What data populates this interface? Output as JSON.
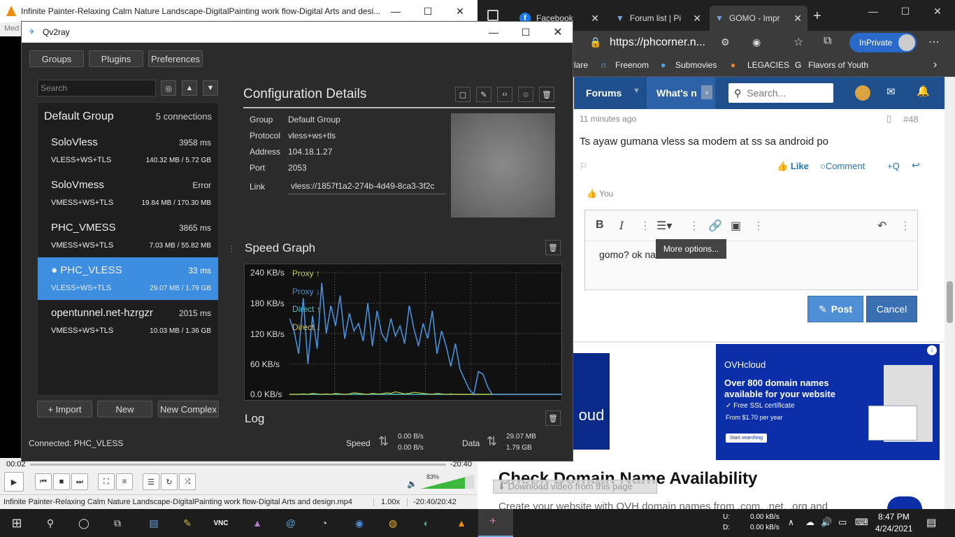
{
  "vlc": {
    "title": "Infinite Painter-Relaxing Calm Nature Landscape-DigitalPainting work flow-Digital Arts and desi...",
    "menu": "Med",
    "time_elapsed": "00:02",
    "time_remaining": "-20:40",
    "volume": "83%",
    "volume_level": 0.83,
    "status_file": "Infinite Painter-Relaxing Calm Nature Landscape-DigitalPainting work flow-Digital Arts and design.mp4",
    "status_speed": "1.00x",
    "status_time": "-20:40/20:42"
  },
  "browser": {
    "tabs": [
      {
        "label": "Facebook"
      },
      {
        "label": "Forum list | Pi"
      },
      {
        "label": "GOMO - Impr"
      }
    ],
    "address": "https://phcorner.n...",
    "inprivate": "InPrivate",
    "favorites": [
      "lare",
      "Freenom",
      "Submovies",
      "LEGACIES",
      "Flavors of Youth"
    ],
    "site": {
      "nav_forums": "Forums",
      "nav_whats_new": "What's n",
      "search_placeholder": "Search...",
      "post_time": "11 minutes ago",
      "post_number": "#48",
      "post_text": "Ts ayaw gumana vless sa modem at ss sa android po",
      "like": "Like",
      "comment": "Comment",
      "quote": "+Q",
      "reaction_you": "You",
      "editor_text": "gomo? ok naman sakin",
      "tooltip": "More options...",
      "post_btn": "Post",
      "cancel_btn": "Cancel",
      "ad_brand": "OVHcloud",
      "ad_headline": "Over 800 domain names available for your website",
      "ad_ssl": "✓ Free SSL certificate",
      "ad_price": "From $1.70 per year",
      "ad_cta": "Start searching",
      "ad_left_text": "oud",
      "heading": "Check Domain Name Availability",
      "download_overlay": "Download video from this page",
      "sub_text": "Create your website with OVH domain names from .com, .net, .org and"
    }
  },
  "qv2ray": {
    "title": "Qv2ray",
    "buttons": {
      "groups": "Groups",
      "plugins": "Plugins",
      "preferences": "Preferences"
    },
    "search_placeholder": "Search",
    "group_name": "Default Group",
    "group_count": "5 connections",
    "connections": [
      {
        "name": "SoloVless",
        "latency": "3958 ms",
        "type": "VLESS+WS+TLS",
        "stats": "140.32 MB / 5.72 GB"
      },
      {
        "name": "SoloVmess",
        "latency": "Error",
        "type": "VMESS+WS+TLS",
        "stats": "19.84 MB / 170.30 MB"
      },
      {
        "name": "PHC_VMESS",
        "latency": "3865 ms",
        "type": "VMESS+WS+TLS",
        "stats": "7.03 MB / 55.82 MB"
      },
      {
        "name": "● PHC_VLESS",
        "latency": "33 ms",
        "type": "VLESS+WS+TLS",
        "stats": "29.07 MB / 1.79 GB"
      },
      {
        "name": "opentunnel.net-hzrgzr",
        "latency": "2015 ms",
        "type": "VMESS+WS+TLS",
        "stats": "10.03 MB / 1.36 GB"
      }
    ],
    "import": "+ Import",
    "new": "New",
    "new_complex": "New Complex",
    "config_title": "Configuration Details",
    "details": [
      {
        "key": "Group",
        "value": "Default Group"
      },
      {
        "key": "Protocol",
        "value": "vless+ws+tls"
      },
      {
        "key": "Address",
        "value": "104.18.1.27"
      },
      {
        "key": "Port",
        "value": "2053"
      }
    ],
    "link_key": "Link",
    "link_value": "vless://1857f1a2-274b-4d49-8ca3-3f2c",
    "speed_graph_title": "Speed Graph",
    "log_title": "Log",
    "connected": "Connected: PHC_VLESS",
    "speed_label": "Speed",
    "speed_up": "0.00 B/s",
    "speed_down": "0.00 B/s",
    "data_label": "Data",
    "data_up": "29.07 MB",
    "data_down": "1.79 GB"
  },
  "chart_data": {
    "type": "line",
    "title": "Speed Graph",
    "y_ticks": [
      "240 KB/s",
      "180 KB/s",
      "120 KB/s",
      "60 KB/s",
      "0.0 KB/s"
    ],
    "ylim": [
      0,
      240
    ],
    "series": [
      {
        "name": "Proxy ↑",
        "color": "#b6d24a",
        "values": [
          0,
          0,
          0,
          1,
          0,
          2,
          1,
          0,
          1,
          0,
          2,
          1,
          0,
          1,
          3,
          2,
          1,
          0,
          2,
          1,
          1,
          3,
          2,
          5,
          3,
          1,
          2,
          4,
          3,
          2,
          1,
          0,
          2,
          1,
          0,
          1,
          0,
          0,
          0,
          0,
          0,
          0,
          0,
          0,
          0,
          0,
          0,
          0,
          0,
          0,
          0,
          0,
          0,
          0,
          0,
          0,
          0,
          0,
          0,
          0
        ]
      },
      {
        "name": "Proxy ↓",
        "color": "#4a90d9",
        "values": [
          150,
          125,
          80,
          190,
          60,
          155,
          90,
          220,
          120,
          175,
          135,
          195,
          110,
          160,
          125,
          140,
          105,
          180,
          95,
          165,
          120,
          105,
          150,
          115,
          135,
          100,
          175,
          130,
          95,
          140,
          110,
          165,
          80,
          125,
          95,
          55,
          100,
          50,
          30,
          10,
          0,
          45,
          40,
          15,
          0,
          0,
          0,
          0,
          0,
          0,
          0,
          0,
          0,
          0,
          0,
          0,
          0,
          0,
          0,
          0
        ]
      },
      {
        "name": "Direct ↑",
        "color": "#3ec7d6",
        "values": [
          0,
          0,
          0,
          0,
          0,
          0,
          0,
          0,
          0,
          0,
          0,
          0,
          0,
          0,
          0,
          0,
          0,
          0,
          0,
          0,
          0,
          0,
          0,
          0,
          0,
          0,
          0,
          0,
          0,
          0,
          0,
          0,
          0,
          0,
          0,
          0,
          0,
          0,
          0,
          0,
          0,
          0,
          0,
          0,
          0,
          0,
          0,
          0,
          0,
          0,
          0,
          0,
          0,
          0,
          0,
          0,
          0,
          0,
          0,
          0
        ]
      },
      {
        "name": "Direct ↓",
        "color": "#d8c45a",
        "values": [
          0,
          0,
          0,
          0,
          0,
          0,
          0,
          0,
          0,
          0,
          0,
          0,
          0,
          0,
          0,
          0,
          0,
          0,
          0,
          0,
          0,
          0,
          0,
          0,
          0,
          0,
          0,
          0,
          0,
          0,
          0,
          0,
          0,
          0,
          0,
          0,
          0,
          0,
          0,
          0,
          0,
          0,
          0,
          0,
          0,
          0,
          0,
          0,
          0,
          0,
          0,
          0,
          0,
          0,
          0,
          0,
          0,
          0,
          0,
          0
        ]
      }
    ],
    "grid": true,
    "legend": "top-left"
  },
  "taskbar": {
    "net_up_label": "U:",
    "net_down_label": "D:",
    "net_up": "0.00 kB/s",
    "net_down": "0.00 kB/s",
    "time": "8:47 PM",
    "date": "4/24/2021"
  }
}
